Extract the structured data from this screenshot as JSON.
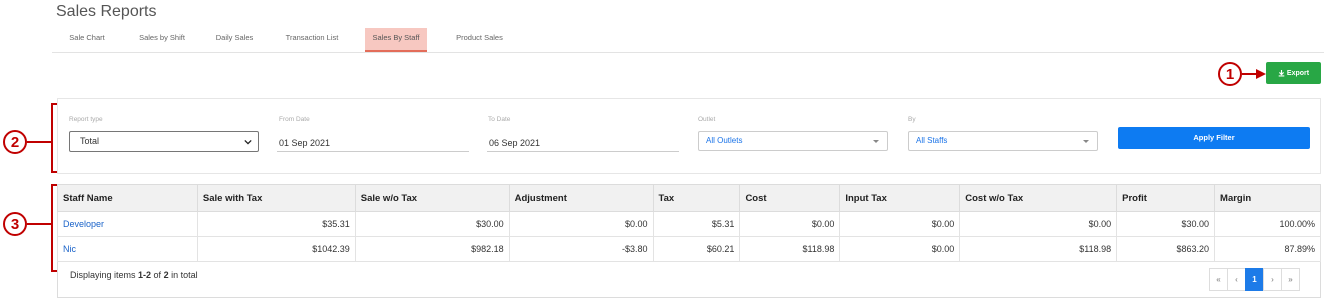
{
  "page": {
    "title": "Sales Reports"
  },
  "tabs": [
    {
      "label": "Sale Chart"
    },
    {
      "label": "Sales by Shift"
    },
    {
      "label": "Daily Sales"
    },
    {
      "label": "Transaction List"
    },
    {
      "label": "Sales By Staff",
      "active": true
    },
    {
      "label": "Product Sales"
    }
  ],
  "toolbar": {
    "export_label": "Export"
  },
  "callouts": [
    "1",
    "2",
    "3"
  ],
  "filters": {
    "report_type": {
      "label": "Report type",
      "value": "Total"
    },
    "from_date": {
      "label": "From Date",
      "value": "01 Sep 2021"
    },
    "to_date": {
      "label": "To Date",
      "value": "06 Sep 2021"
    },
    "outlet": {
      "label": "Outlet",
      "value": "All Outlets"
    },
    "by": {
      "label": "By",
      "value": "All Staffs"
    },
    "apply_label": "Apply Filter"
  },
  "table": {
    "columns": [
      "Staff Name",
      "Sale with Tax",
      "Sale w/o Tax",
      "Adjustment",
      "Tax",
      "Cost",
      "Input Tax",
      "Cost w/o Tax",
      "Profit",
      "Margin"
    ],
    "rows": [
      [
        "Developer",
        "$35.31",
        "$30.00",
        "$0.00",
        "$5.31",
        "$0.00",
        "$0.00",
        "$0.00",
        "$30.00",
        "100.00%"
      ],
      [
        "Nic",
        "$1042.39",
        "$982.18",
        "-$3.80",
        "$60.21",
        "$118.98",
        "$0.00",
        "$118.98",
        "$863.20",
        "87.89%"
      ]
    ]
  },
  "footer": {
    "prefix": "Displaying items ",
    "range": "1-2",
    "mid": " of ",
    "total": "2",
    "suffix": " in total"
  },
  "pagination": {
    "first": "«",
    "prev": "‹",
    "current": "1",
    "next": "›",
    "last": "»"
  },
  "colors": {
    "export": "#28a745",
    "apply": "#0d7bf2",
    "active_tab": "#f7c8c1",
    "callout": "#c00000",
    "link": "#1a63c9"
  }
}
